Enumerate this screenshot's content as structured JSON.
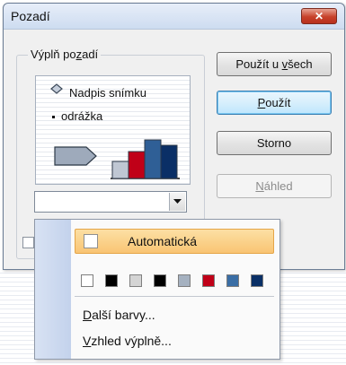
{
  "dialog": {
    "title": "Pozadí",
    "close_glyph": "✕"
  },
  "group": {
    "label": "Výplň pozadí"
  },
  "preview": {
    "title_text": "Nadpis snímku",
    "bullet_text": "odrážka",
    "chart_colors": [
      "#bfc7d3",
      "#c00018",
      "#2f5f96",
      "#0a2f66"
    ]
  },
  "buttons": {
    "apply_all": {
      "pre": "Použít u ",
      "u": "v",
      "post": "šech"
    },
    "apply": {
      "pre": "",
      "u": "P",
      "post": "oužít"
    },
    "cancel": "Storno",
    "preview": {
      "pre": "",
      "u": "N",
      "post": "áhled"
    }
  },
  "popup": {
    "automatic_label": "Automatická",
    "swatches": [
      {
        "name": "white",
        "color": "#ffffff"
      },
      {
        "name": "black",
        "color": "#000000"
      },
      {
        "name": "light-gray",
        "color": "#d4d4d4"
      },
      {
        "name": "black-2",
        "color": "#000000"
      },
      {
        "name": "blue-gray",
        "color": "#a5b1c0"
      },
      {
        "name": "red",
        "color": "#c00018"
      },
      {
        "name": "steel-blue",
        "color": "#3a6ea5"
      },
      {
        "name": "navy",
        "color": "#0a2f66"
      }
    ],
    "more_colors": {
      "u": "D",
      "post": "alší barvy..."
    },
    "fill_effects": {
      "u": "V",
      "post": "zhled výplně..."
    }
  },
  "icons": {
    "close": "close-icon",
    "dropdown": "chevron-down-icon",
    "title_marker": "diamond-bullet-icon"
  }
}
